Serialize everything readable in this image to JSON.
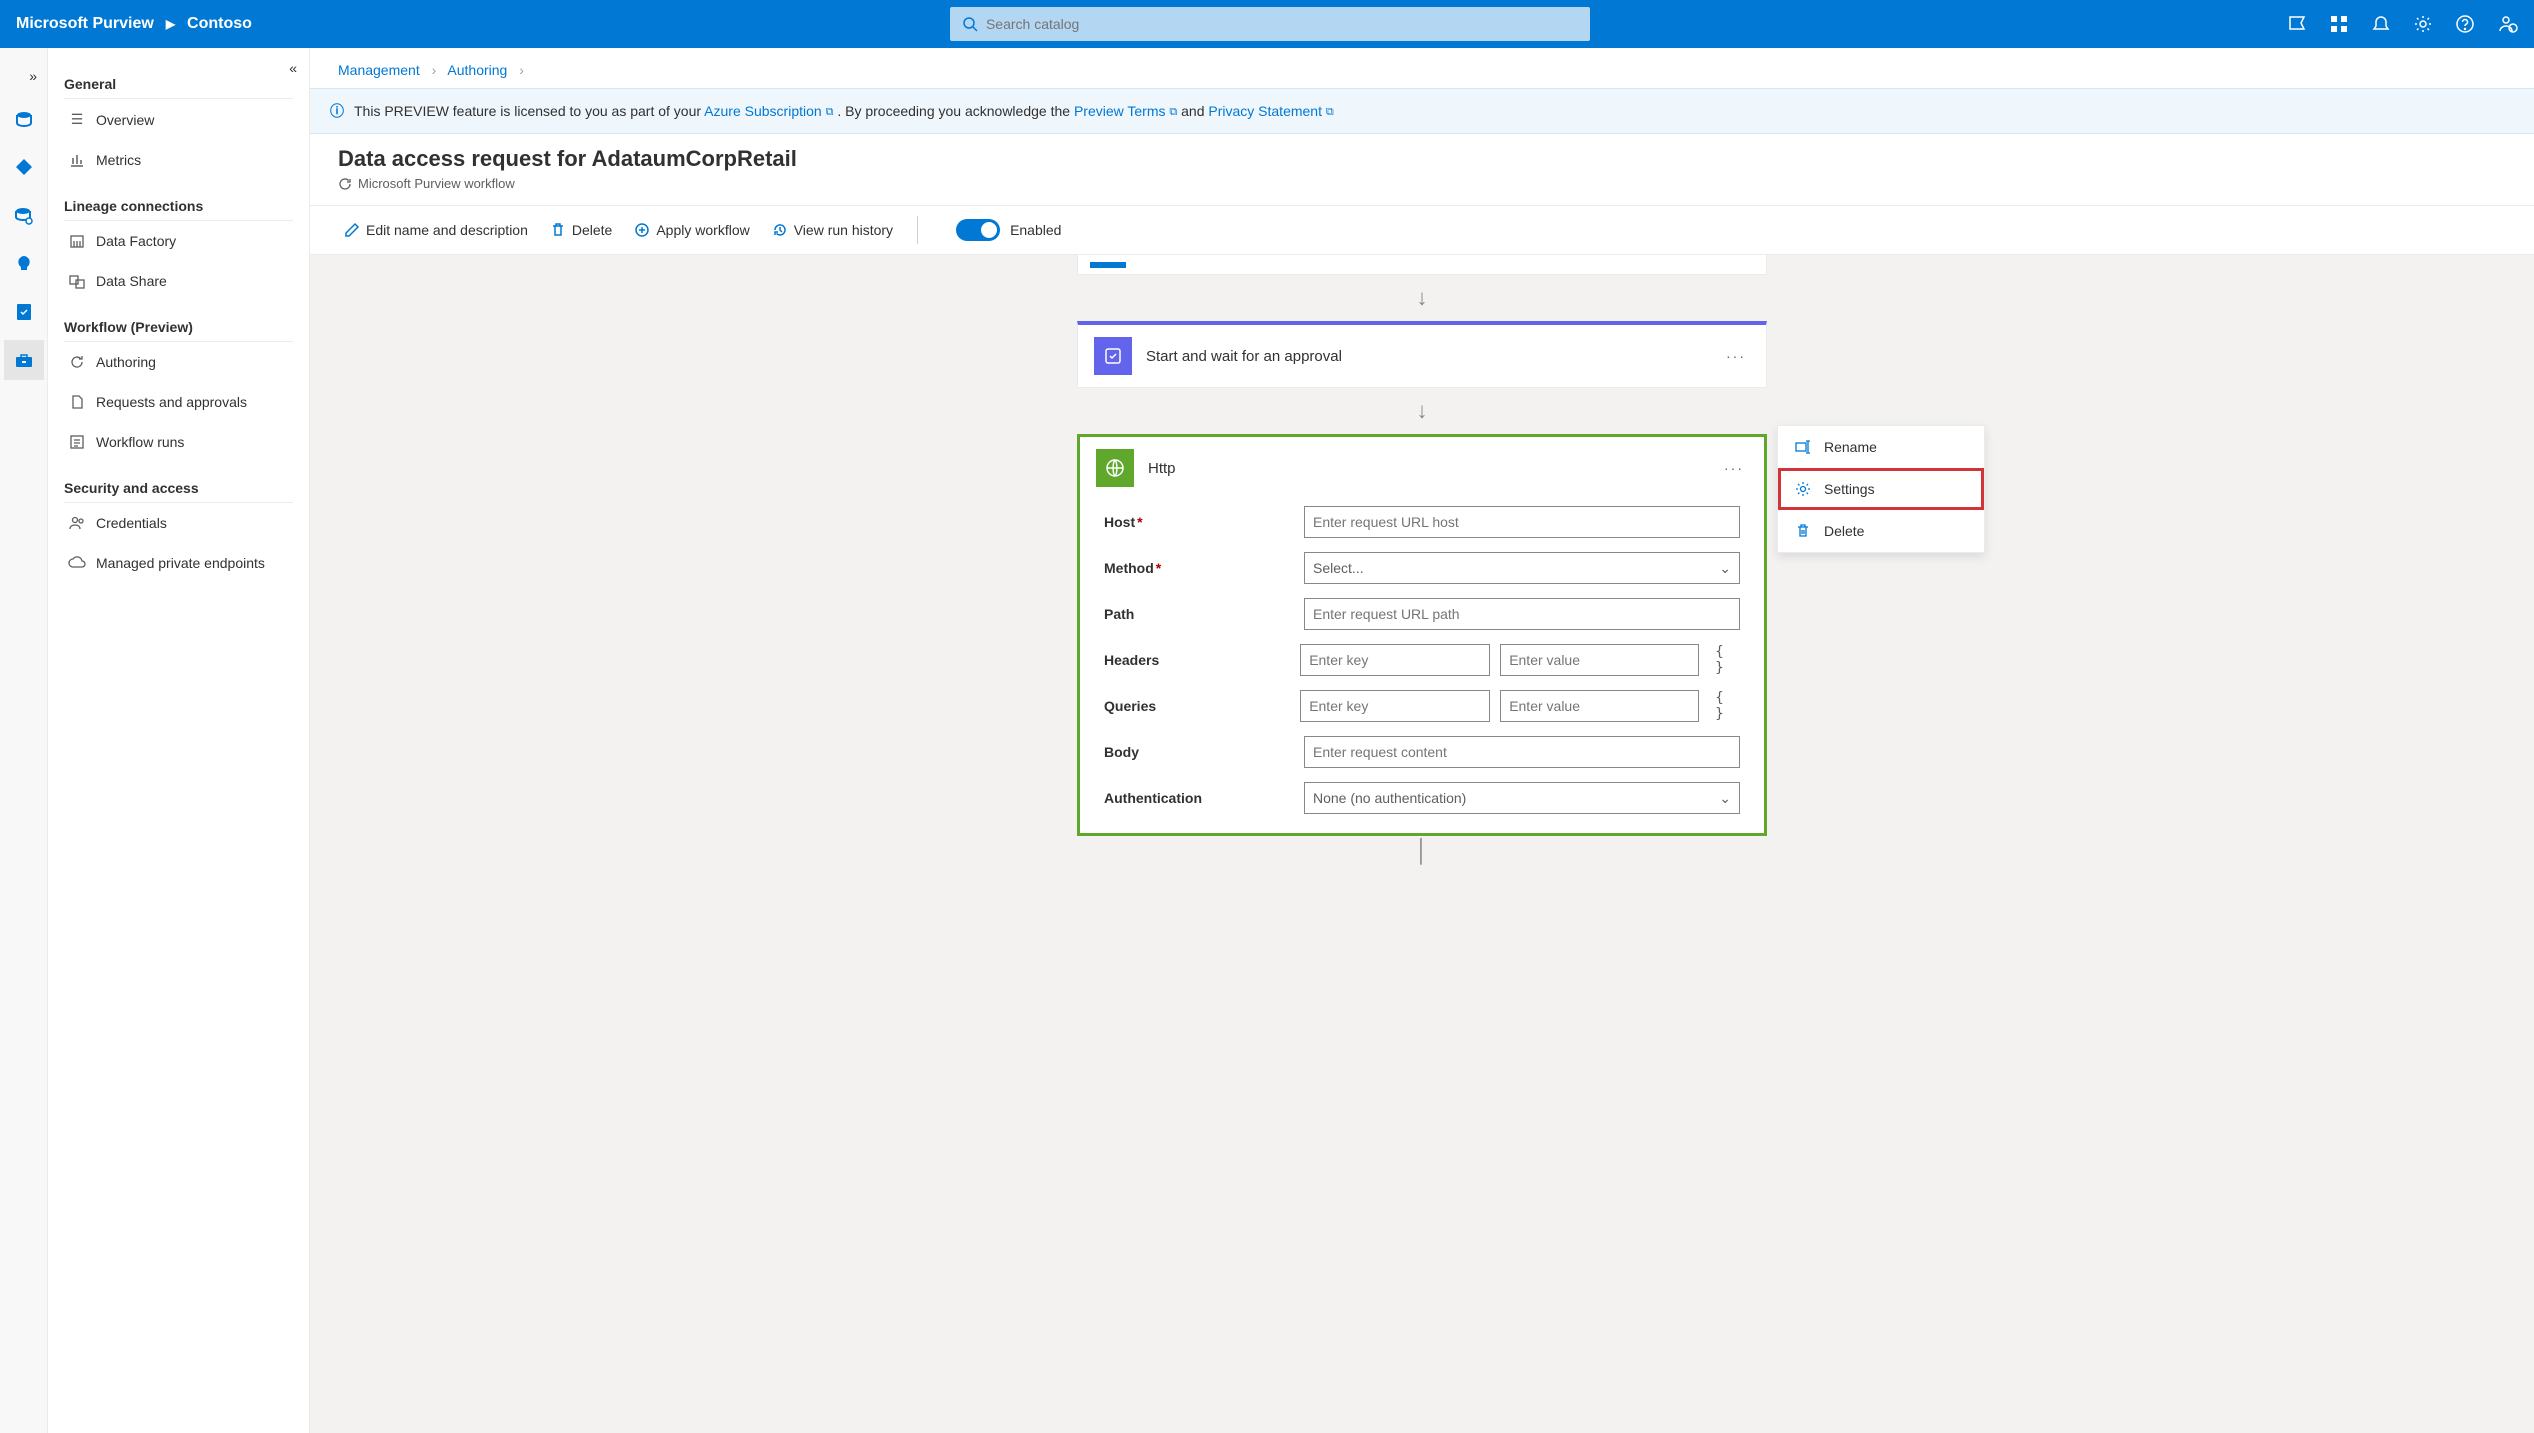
{
  "topbar": {
    "brand": "Microsoft Purview",
    "tenant": "Contoso",
    "search_placeholder": "Search catalog"
  },
  "leftnav": {
    "general": {
      "title": "General",
      "overview": "Overview",
      "metrics": "Metrics"
    },
    "lineage": {
      "title": "Lineage connections",
      "factory": "Data Factory",
      "share": "Data Share"
    },
    "workflow": {
      "title": "Workflow (Preview)",
      "authoring": "Authoring",
      "requests": "Requests and approvals",
      "runs": "Workflow runs"
    },
    "security": {
      "title": "Security and access",
      "creds": "Credentials",
      "endpoints": "Managed private endpoints"
    }
  },
  "crumbs": {
    "a": "Management",
    "b": "Authoring"
  },
  "banner": {
    "pre": "This PREVIEW feature is licensed to you as part of your ",
    "sub": "Azure Subscription",
    "mid": ". By proceeding you acknowledge the ",
    "terms": "Preview Terms",
    "and": " and  ",
    "privacy": "Privacy Statement"
  },
  "page": {
    "title": "Data access request for AdataumCorpRetail",
    "subtitle": "Microsoft Purview workflow"
  },
  "cmd": {
    "edit": "Edit name and description",
    "delete": "Delete",
    "apply": "Apply workflow",
    "history": "View run history",
    "enabled": "Enabled"
  },
  "cards": {
    "approval_title": "Start and wait for an approval",
    "http": {
      "title": "Http",
      "host_label": "Host",
      "host_ph": "Enter request URL host",
      "method_label": "Method",
      "method_ph": "Select...",
      "path_label": "Path",
      "path_ph": "Enter request URL path",
      "headers_label": "Headers",
      "key_ph": "Enter key",
      "val_ph": "Enter value",
      "queries_label": "Queries",
      "body_label": "Body",
      "body_ph": "Enter request content",
      "auth_label": "Authentication",
      "auth_val": "None (no authentication)"
    }
  },
  "ctx": {
    "rename": "Rename",
    "settings": "Settings",
    "delete": "Delete"
  }
}
